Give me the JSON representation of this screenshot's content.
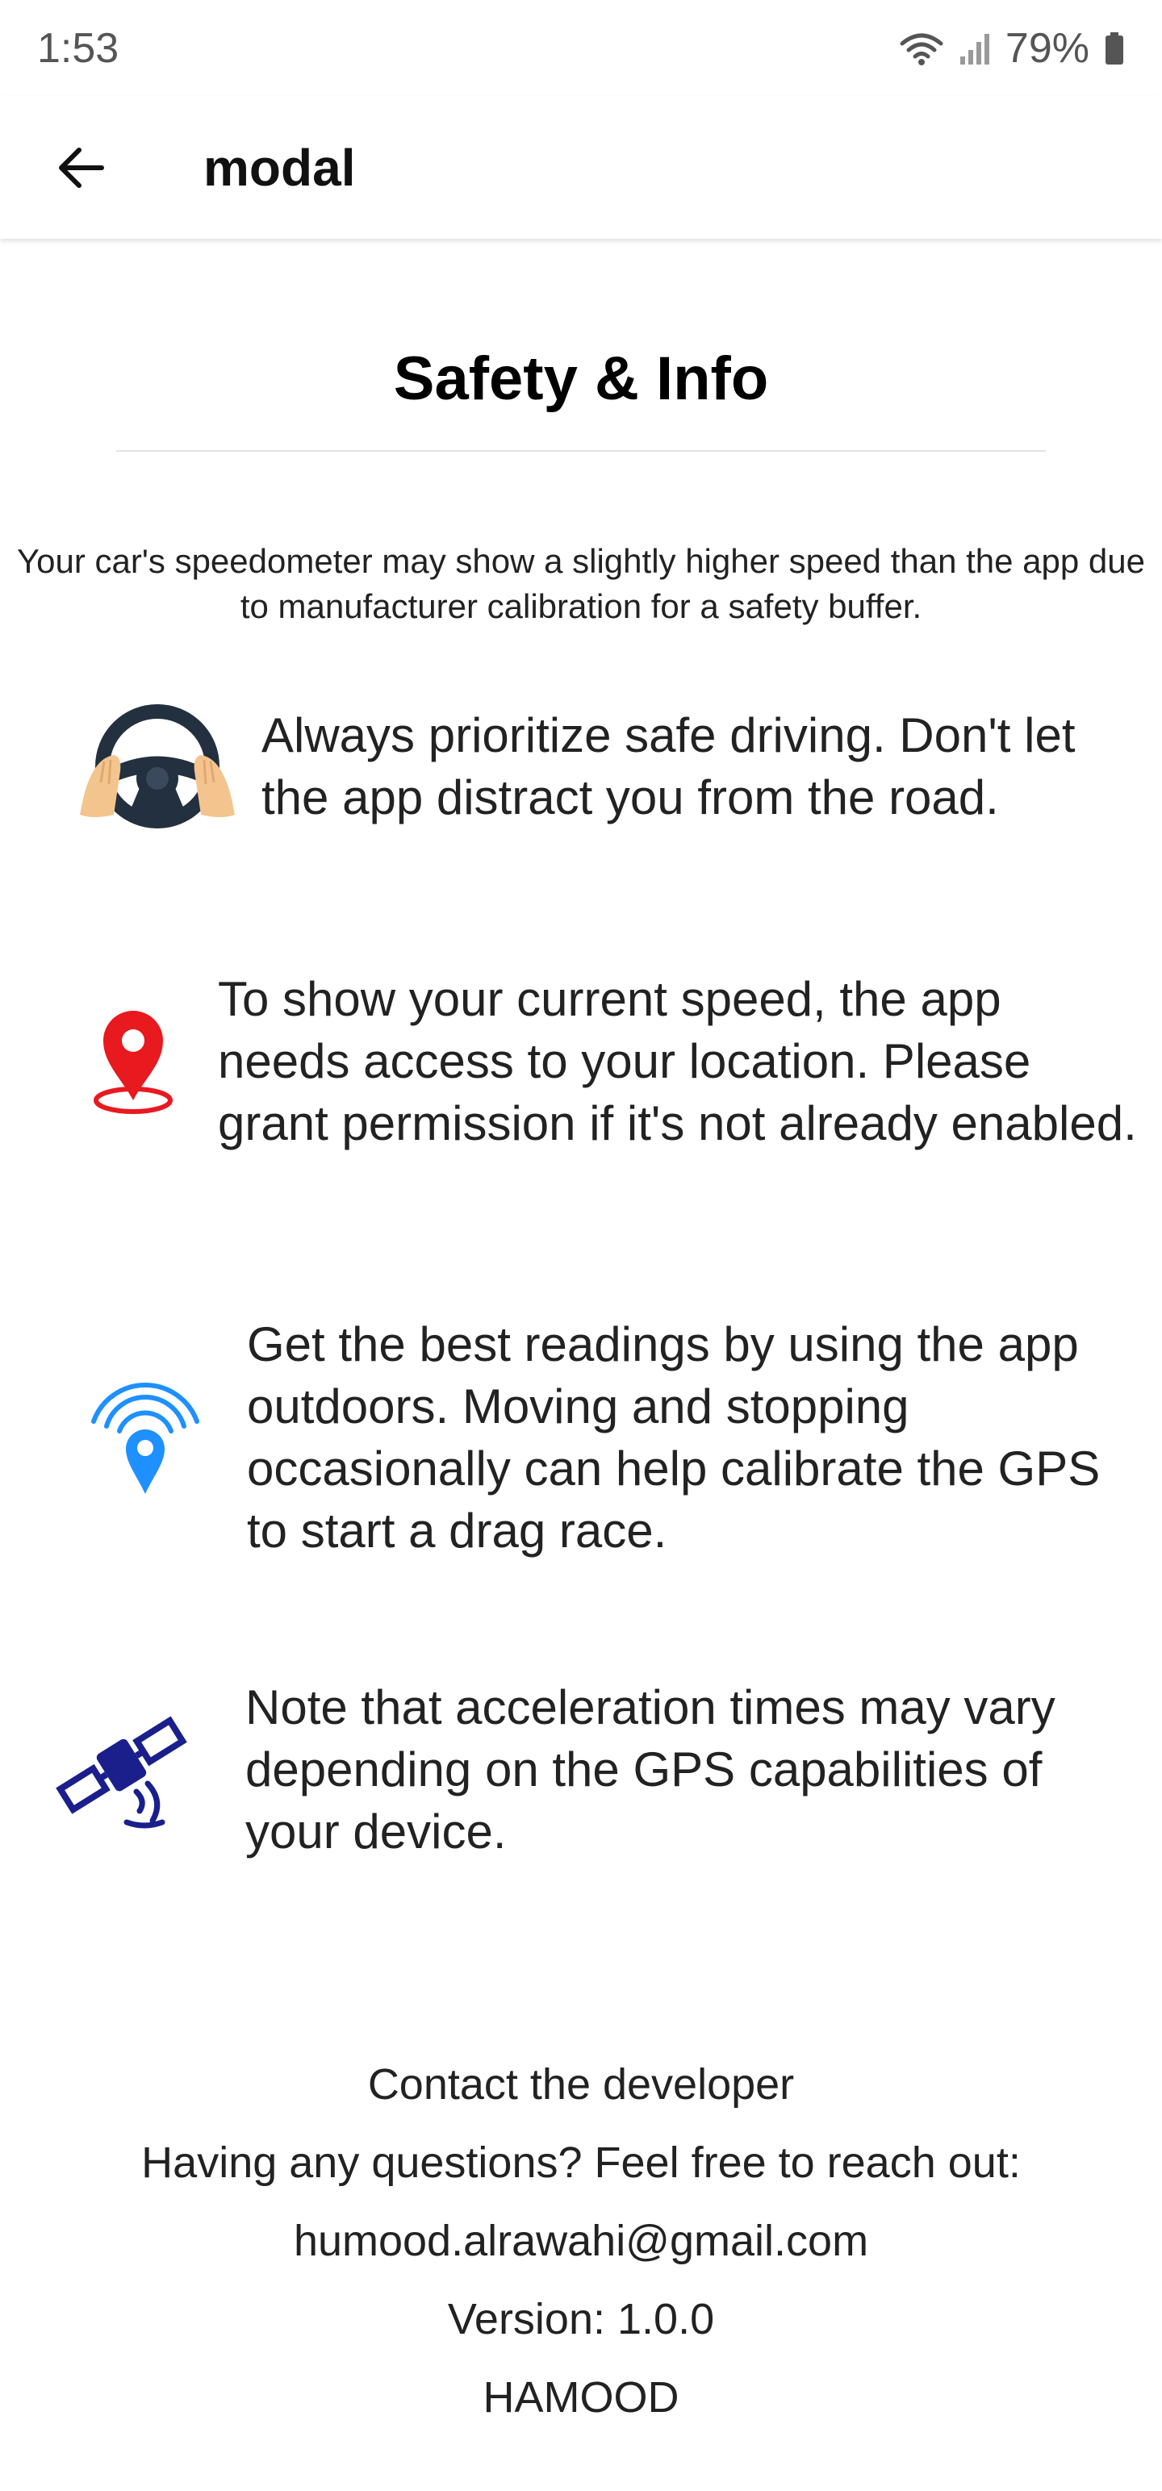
{
  "status_bar": {
    "time": "1:53",
    "battery_percent": "79%",
    "icons": [
      "wifi-icon",
      "signal-icon",
      "battery-icon"
    ]
  },
  "app_bar": {
    "back_icon": "arrow-left-icon",
    "title": "modal"
  },
  "section": {
    "title": "Safety & Info",
    "intro": "Your car's speedometer may show a slightly higher speed than the app due to manufacturer calibration for a safety buffer."
  },
  "tips": [
    {
      "icon": "steering-wheel-icon",
      "text": "Always prioritize safe driving. Don't let the app distract you from the road."
    },
    {
      "icon": "location-pin-icon",
      "text": "To show your current speed, the app needs access to your location. Please grant permission if it's not already enabled."
    },
    {
      "icon": "gps-signal-icon",
      "text": "Get the best readings by using the app outdoors. Moving and stopping occasionally can help calibrate the GPS to start a drag race."
    },
    {
      "icon": "satellite-icon",
      "text": "Note that acceleration times may vary depending on the GPS capabilities of your device."
    }
  ],
  "footer": {
    "contact_heading": "Contact the developer",
    "questions": "Having any questions? Feel free to reach out:",
    "email": "humood.alrawahi@gmail.com",
    "version": "Version: 1.0.0",
    "author": "HAMOOD"
  },
  "colors": {
    "pin_red": "#e8191f",
    "gps_blue": "#1e90ff",
    "satellite_navy": "#1a1f8c",
    "wheel_dark": "#22303f",
    "skin": "#f4c48f"
  }
}
